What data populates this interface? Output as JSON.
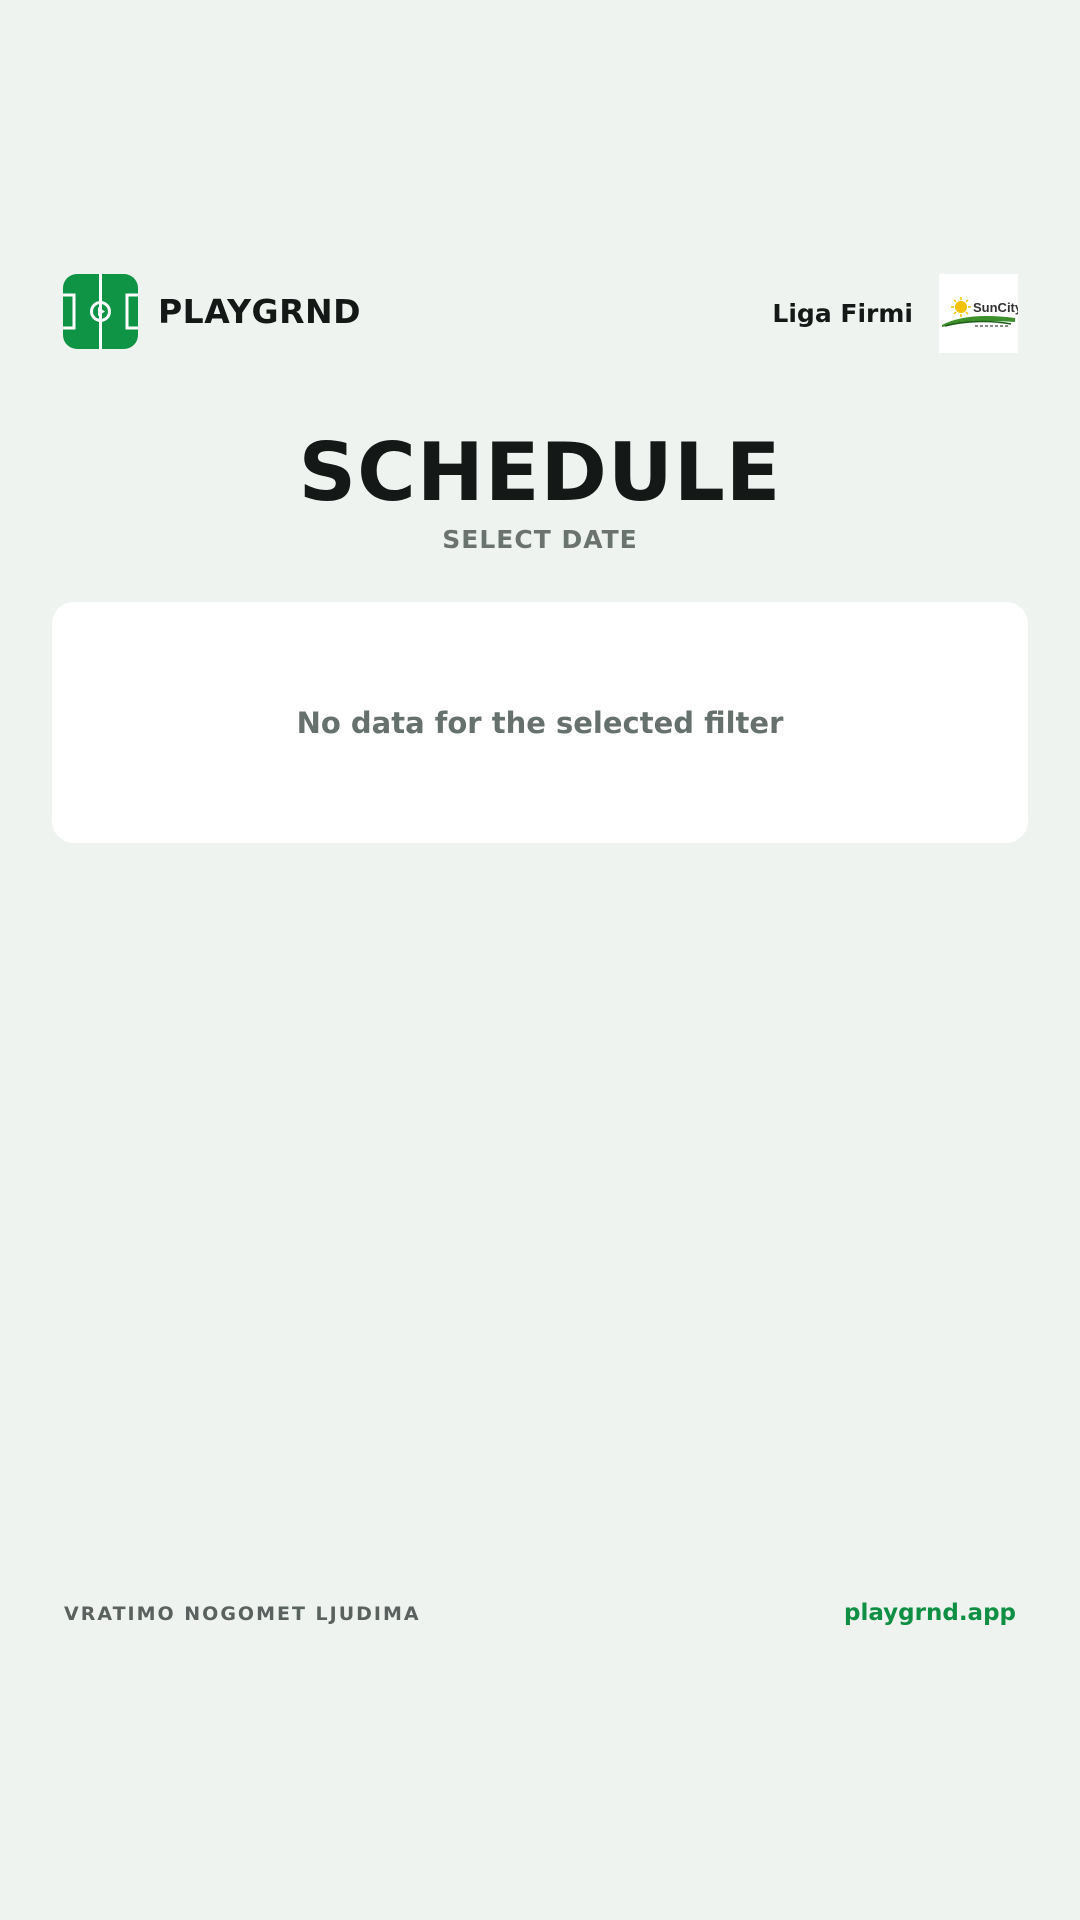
{
  "header": {
    "brand_name": "PLAYGRND",
    "league_name": "Liga Firmi",
    "sponsor_logo_text": "SunCity"
  },
  "main": {
    "title": "SCHEDULE",
    "subtitle": "SELECT DATE",
    "empty_message": "No data for the selected filter"
  },
  "footer": {
    "tagline": "VRATIMO NOGOMET LJUDIMA",
    "link": "playgrnd.app"
  },
  "colors": {
    "background": "#eff3f0",
    "brand_green": "#0f9446",
    "text_dark": "#141917",
    "text_muted": "#6b736f",
    "card": "#ffffff",
    "link": "#0f8f44"
  },
  "icons": {
    "brand_logo": "football-pitch-icon",
    "sponsor_logo": "suncity-logo"
  }
}
